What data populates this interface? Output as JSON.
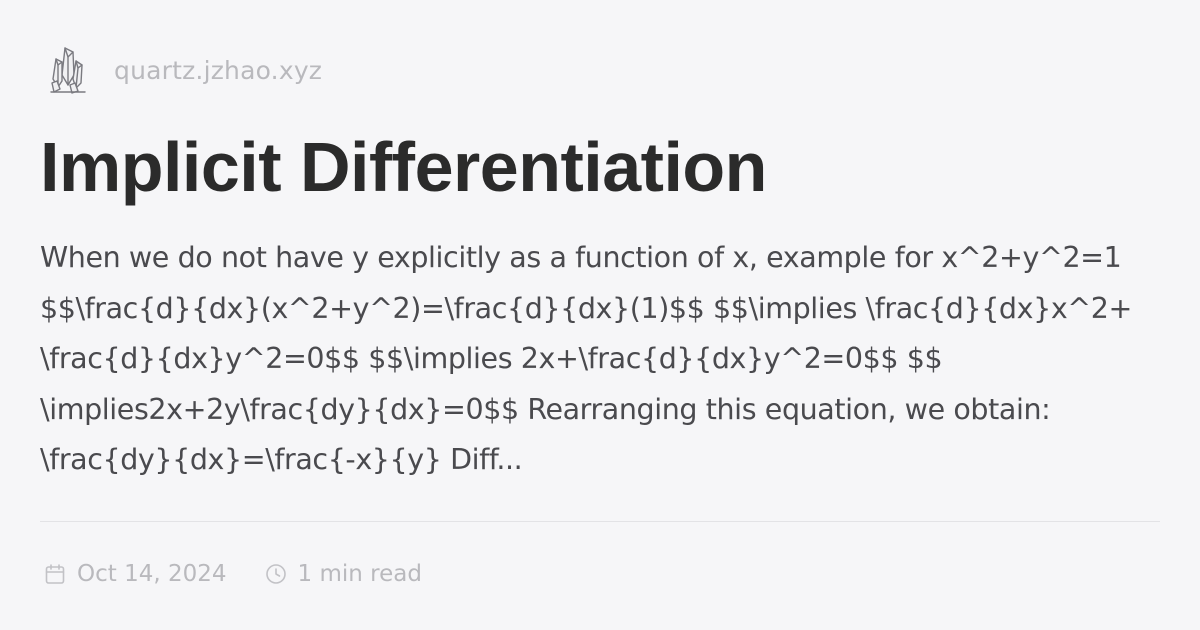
{
  "site": {
    "name": "quartz.jzhao.xyz",
    "logo_icon": "crystal-icon"
  },
  "article": {
    "title": "Implicit Differentiation",
    "excerpt_lines": [
      "When we do not have y explicitly as a function of x, example for x^2+y^2=1",
      "$$\\frac{d}{dx}(x^2+y^2)=\\frac{d}{dx}(1)$$ $$\\implies \\frac{d}{dx}x^2+",
      "\\frac{d}{dx}y^2=0$$ $$\\implies 2x+\\frac{d}{dx}y^2=0$$ $$",
      "\\implies2x+2y\\frac{dy}{dx}=0$$ Rearranging this equation, we obtain:",
      "\\frac{dy}{dx}=\\frac{-x}{y} Diff..."
    ]
  },
  "meta": {
    "date": "Oct 14, 2024",
    "date_icon": "calendar-icon",
    "reading_time": "1 min read",
    "reading_time_icon": "clock-icon"
  },
  "colors": {
    "background": "#f6f6f8",
    "title": "#2b2b2b",
    "body_text": "#4a4a4e",
    "muted": "#b9b9bd",
    "divider": "#e3e3e6"
  }
}
